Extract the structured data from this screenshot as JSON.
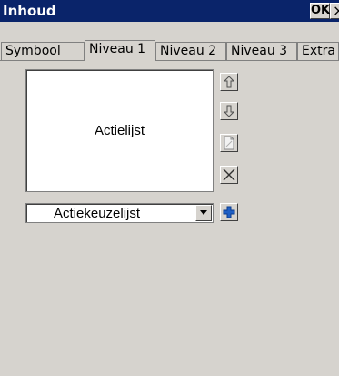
{
  "window": {
    "title": "Inhoud",
    "ok_label": "OK",
    "close_label": "×"
  },
  "tabs": [
    {
      "label": "Symbool",
      "active": false
    },
    {
      "label": "Niveau 1",
      "active": true
    },
    {
      "label": "Niveau 2",
      "active": false
    },
    {
      "label": "Niveau 3",
      "active": false
    },
    {
      "label": "Extra",
      "active": false
    }
  ],
  "action_list": {
    "label": "Actielijst"
  },
  "buttons": {
    "move_up_icon": "arrow-up-icon",
    "move_down_icon": "arrow-down-icon",
    "edit_icon": "document-icon",
    "delete_icon": "x-icon",
    "add_icon": "plus-icon"
  },
  "action_select": {
    "value": "Actiekeuzelijst"
  },
  "colors": {
    "titlebar": "#0a246a",
    "background": "#d6d3ce",
    "plus_blue": "#1f5fc4"
  }
}
